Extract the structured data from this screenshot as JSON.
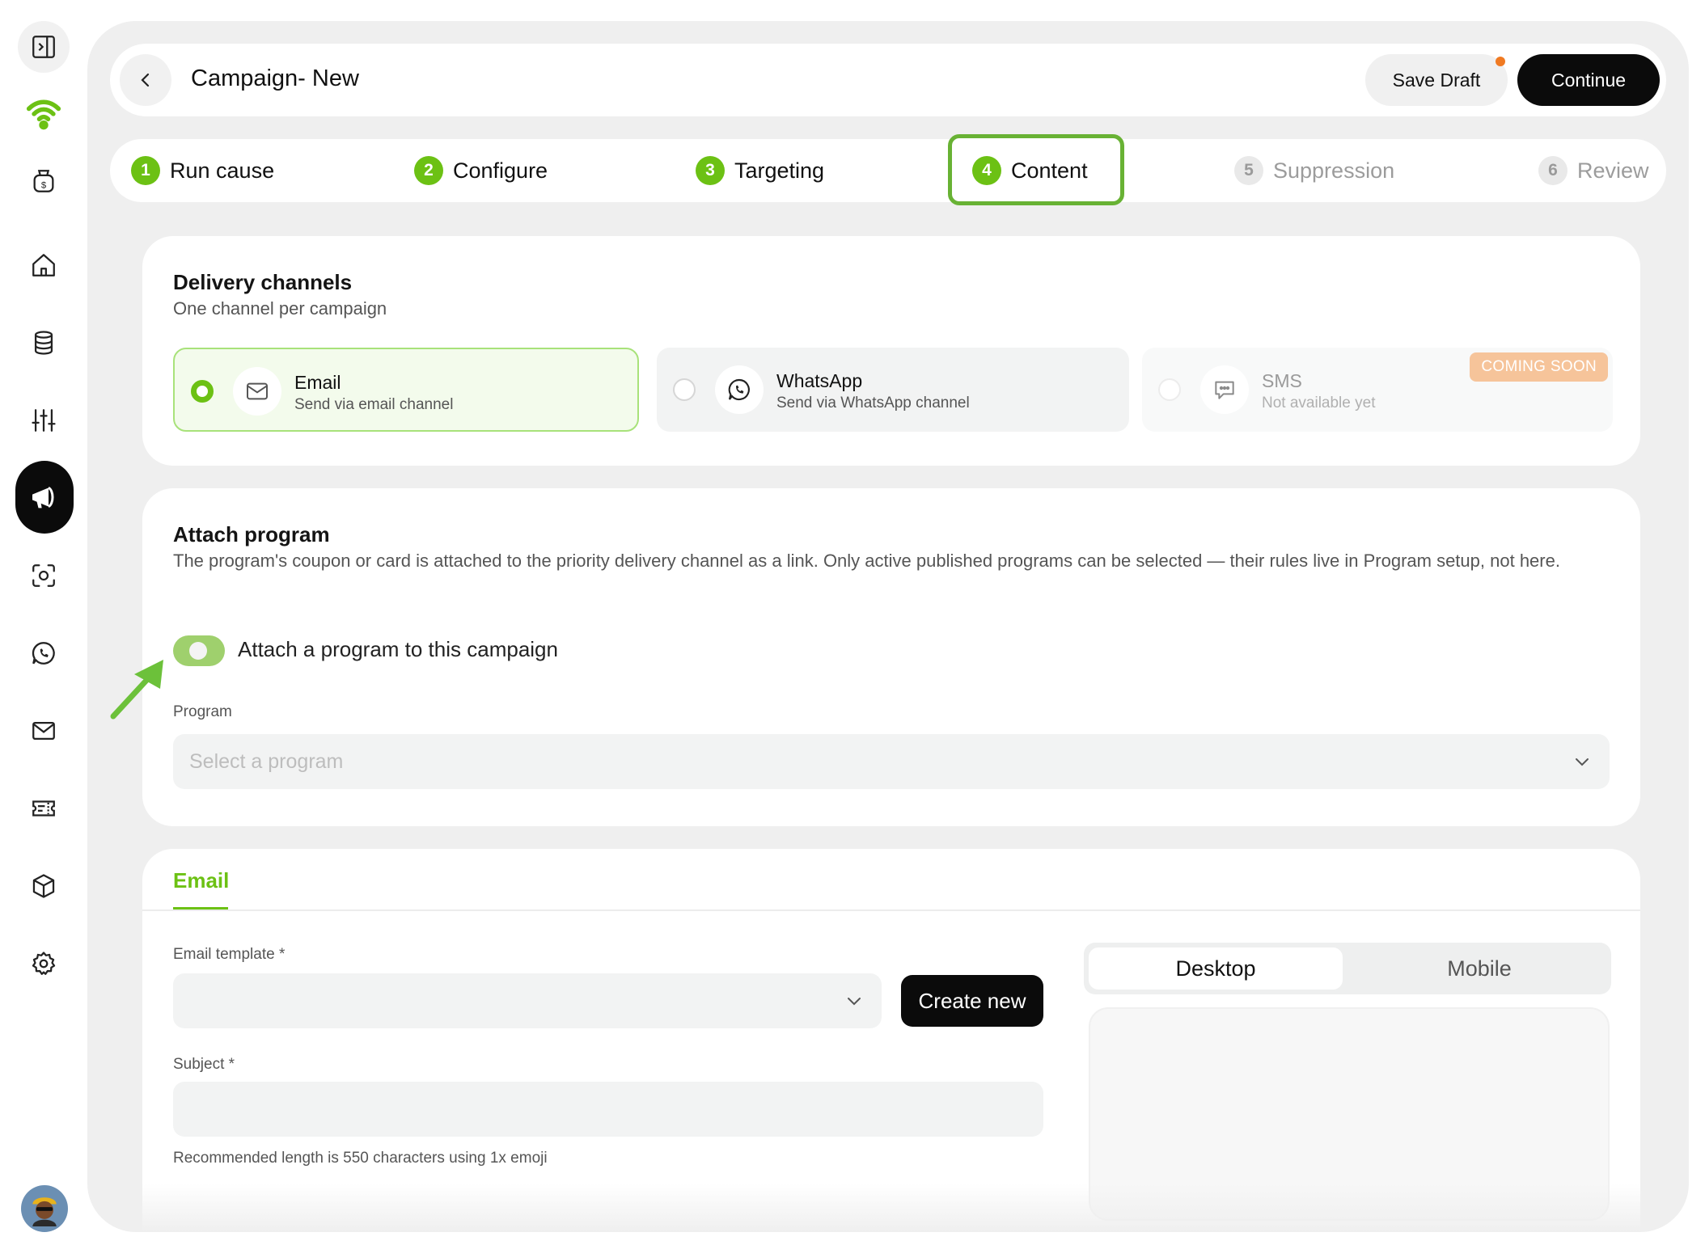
{
  "header": {
    "title": "Campaign- New",
    "save_draft_label": "Save Draft",
    "continue_label": "Continue"
  },
  "steps": [
    {
      "num": "1",
      "label": "Run cause",
      "state": "complete"
    },
    {
      "num": "2",
      "label": "Configure",
      "state": "complete"
    },
    {
      "num": "3",
      "label": "Targeting",
      "state": "complete"
    },
    {
      "num": "4",
      "label": "Content",
      "state": "current"
    },
    {
      "num": "5",
      "label": "Suppression",
      "state": "upcoming"
    },
    {
      "num": "6",
      "label": "Review",
      "state": "upcoming"
    }
  ],
  "delivery": {
    "title": "Delivery channels",
    "subtitle": "One channel per campaign",
    "channels": [
      {
        "name": "Email",
        "desc": "Send via email channel",
        "icon": "mail-icon",
        "selected": true
      },
      {
        "name": "WhatsApp",
        "desc": "Send via WhatsApp channel",
        "icon": "whatsapp-icon",
        "selected": false
      },
      {
        "name": "SMS",
        "desc": "Not available yet",
        "icon": "chat-bubble-icon",
        "selected": false,
        "badge": "COMING SOON"
      }
    ]
  },
  "program": {
    "title": "Attach program",
    "description": "The program's coupon or card is attached to the priority delivery channel as a link. Only active published programs can be selected — their rules live in Program setup, not here.",
    "toggle_label": "Attach a program to this campaign",
    "toggle_on": true,
    "field_label": "Program",
    "placeholder": "Select a program"
  },
  "email": {
    "tab_label": "Email",
    "template_label": "Email template *",
    "create_new_label": "Create new",
    "subject_label": "Subject *",
    "helper": "Recommended length is 550 characters using 1x emoji",
    "preview_tabs": [
      "Desktop",
      "Mobile"
    ]
  },
  "colors": {
    "accent": "#6cc114",
    "highlight_border": "#68b234",
    "dark": "#0b0b0b",
    "badge": "#f6c49a",
    "draft_dot": "#f07a22"
  }
}
